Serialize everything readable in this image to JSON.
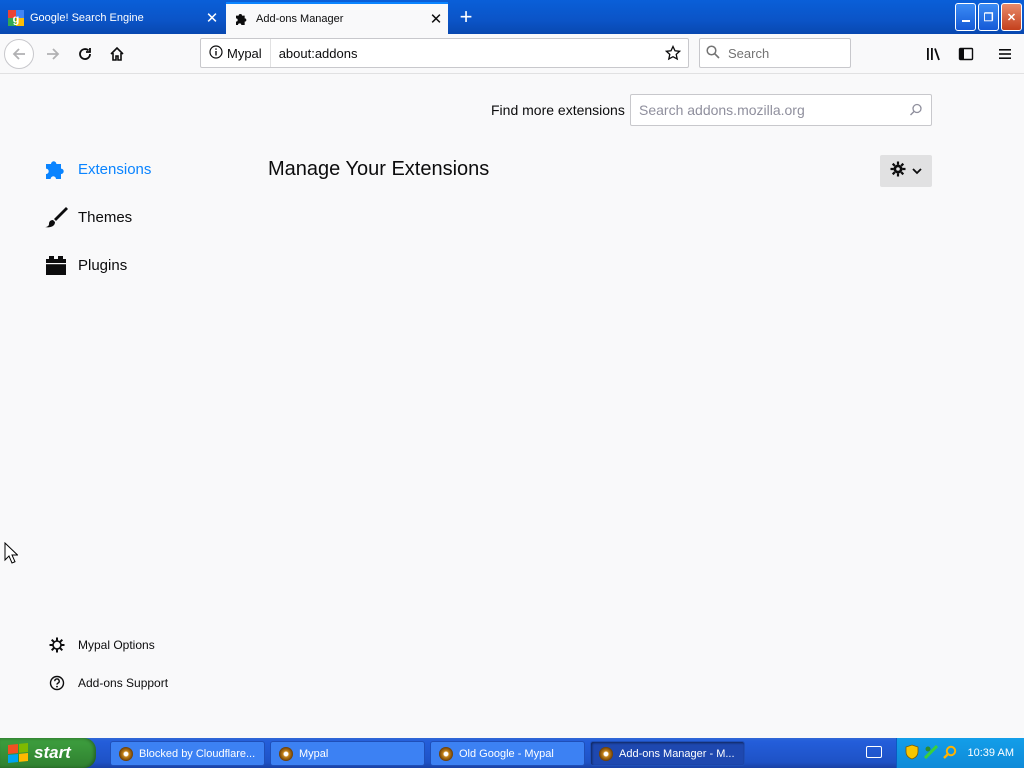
{
  "tabs": [
    {
      "title": "Google! Search Engine",
      "active": false,
      "icon": "google-favicon"
    },
    {
      "title": "Add-ons Manager",
      "active": true,
      "icon": "puzzle-icon"
    }
  ],
  "toolbar": {
    "identity_label": "Mypal",
    "url": "about:addons",
    "search_placeholder": "Search"
  },
  "addons": {
    "find_more_label": "Find more extensions",
    "search_placeholder": "Search addons.mozilla.org",
    "heading": "Manage Your Extensions",
    "categories": [
      {
        "label": "Extensions",
        "icon": "puzzle-icon",
        "selected": true
      },
      {
        "label": "Themes",
        "icon": "brush-icon",
        "selected": false
      },
      {
        "label": "Plugins",
        "icon": "plugin-icon",
        "selected": false
      }
    ],
    "footer_links": [
      {
        "label": "Mypal Options",
        "icon": "gear-icon"
      },
      {
        "label": "Add-ons Support",
        "icon": "help-icon"
      }
    ]
  },
  "taskbar": {
    "start_label": "start",
    "tasks": [
      {
        "label": "Blocked by Cloudflare...",
        "active": false
      },
      {
        "label": "Mypal",
        "active": false
      },
      {
        "label": "Old Google - Mypal",
        "active": false
      },
      {
        "label": "Add-ons Manager - M...",
        "active": true
      }
    ],
    "clock": "10:39 AM"
  },
  "colors": {
    "accent": "#0a84ff",
    "titlebar": "#0b54c7",
    "taskbar": "#245edb",
    "start_green": "#3b9a3c"
  }
}
